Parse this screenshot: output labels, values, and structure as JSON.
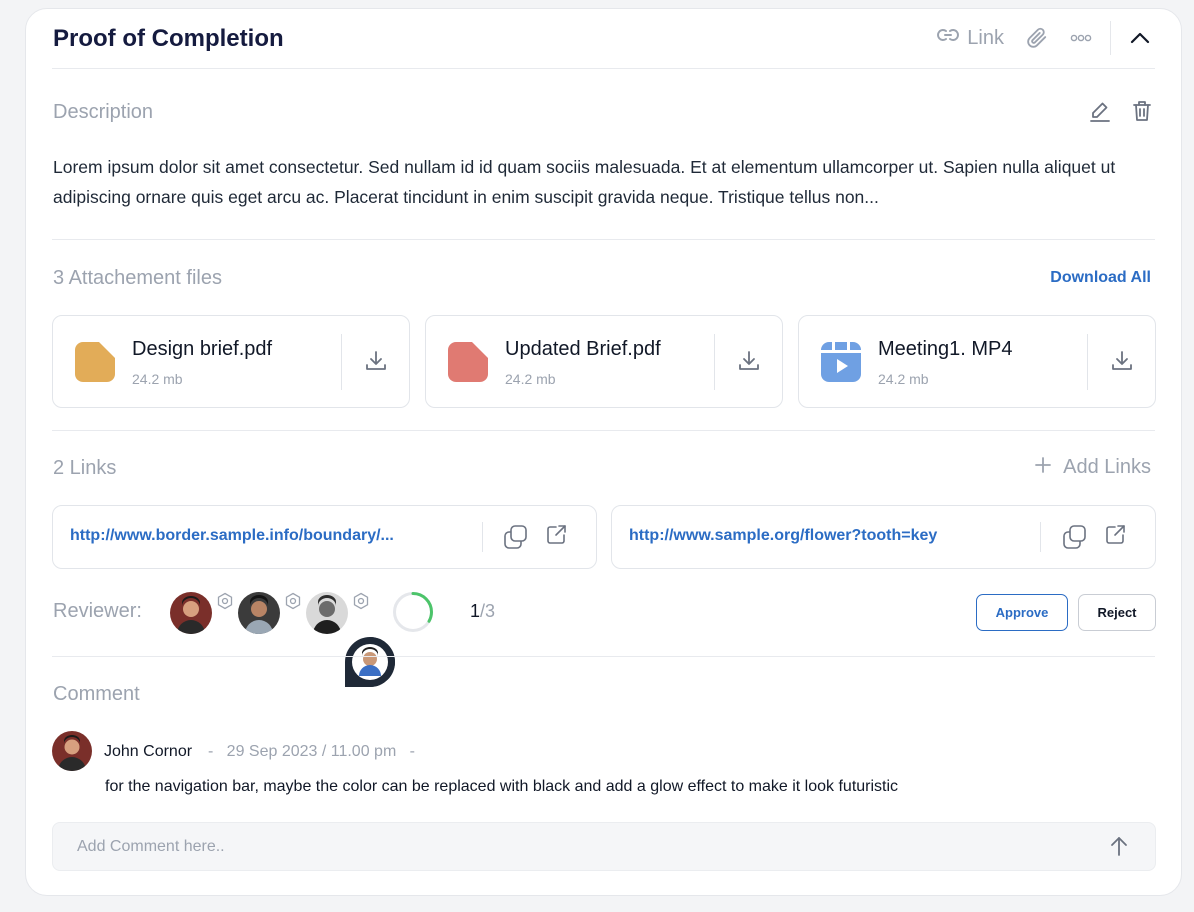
{
  "header": {
    "title": "Proof of Completion",
    "link_label": "Link"
  },
  "description": {
    "label": "Description",
    "text": "Lorem ipsum dolor sit amet consectetur. Sed nullam id id quam sociis malesuada. Et at elementum ullamcorper ut. Sapien nulla aliquet ut adipiscing ornare quis eget arcu ac. Placerat tincidunt in enim suscipit gravida neque. Tristique tellus non..."
  },
  "attachments": {
    "label": "3 Attachement files",
    "download_all": "Download All",
    "files": [
      {
        "name": "Design brief.pdf",
        "size": "24.2 mb",
        "color": "#e2ac58",
        "icon": "document-icon"
      },
      {
        "name": "Updated Brief.pdf",
        "size": "24.2 mb",
        "color": "#e07a72",
        "icon": "document-icon"
      },
      {
        "name": "Meeting1. MP4",
        "size": "24.2 mb",
        "color": "#6fa0e3",
        "icon": "video-icon"
      }
    ]
  },
  "links": {
    "label": "2 Links",
    "add_label": "Add Links",
    "items": [
      {
        "url": "http://www.border.sample.info/boundary/..."
      },
      {
        "url": "http://www.sample.org/flower?tooth=key"
      }
    ]
  },
  "reviewers": {
    "label": "Reviewer:",
    "approved": "1",
    "total": "/3",
    "progress": 0.333,
    "approve_label": "Approve",
    "reject_label": "Reject"
  },
  "comments": {
    "label": "Comment",
    "items": [
      {
        "author": "John Cornor",
        "meta": "-   29 Sep 2023 / 11.00 pm   -",
        "text": "for the navigation bar, maybe the color can be replaced with black and add a glow effect to make it look futuristic"
      }
    ],
    "input_placeholder": "Add Comment here.."
  },
  "colors": {
    "accent": "#2b6cc4",
    "progress": "#4cc46a",
    "muted": "#9ca3af"
  }
}
